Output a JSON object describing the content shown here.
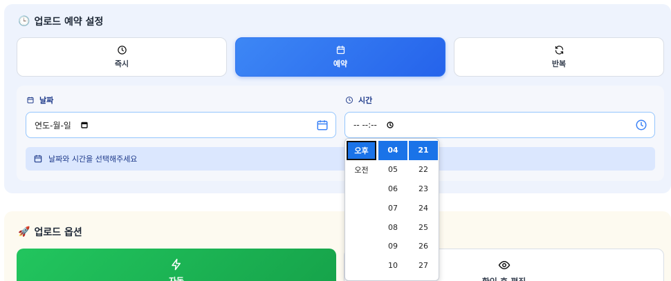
{
  "schedule": {
    "title": "업로드 예약 설정",
    "title_emoji": "🕒",
    "modes": [
      {
        "label": "즉시",
        "icon": "clock-icon",
        "active": false
      },
      {
        "label": "예약",
        "icon": "calendar-icon",
        "active": true
      },
      {
        "label": "반복",
        "icon": "refresh-icon",
        "active": false
      }
    ],
    "date_label": "날짜",
    "date_value": "연도-월-일",
    "time_label": "시간",
    "time_value": "-- --:--",
    "hint": "날짜와 시간을 선택해주세요"
  },
  "time_picker": {
    "ampm": [
      "오후",
      "오전"
    ],
    "hours": [
      "04",
      "05",
      "06",
      "07",
      "08",
      "09",
      "10"
    ],
    "minutes": [
      "21",
      "22",
      "23",
      "24",
      "25",
      "26",
      "27"
    ],
    "selected_ampm": "오후",
    "selected_hour": "04",
    "selected_minute": "21"
  },
  "options": {
    "title": "업로드 옵션",
    "title_emoji": "🚀",
    "cards": [
      {
        "label": "자동",
        "icon": "lightning-icon"
      },
      {
        "label": "확인 후 편집",
        "icon": "eye-icon"
      }
    ]
  },
  "colors": {
    "accent": "#2563eb",
    "success": "#16a34a",
    "picker_selected": "#1a73e8"
  }
}
